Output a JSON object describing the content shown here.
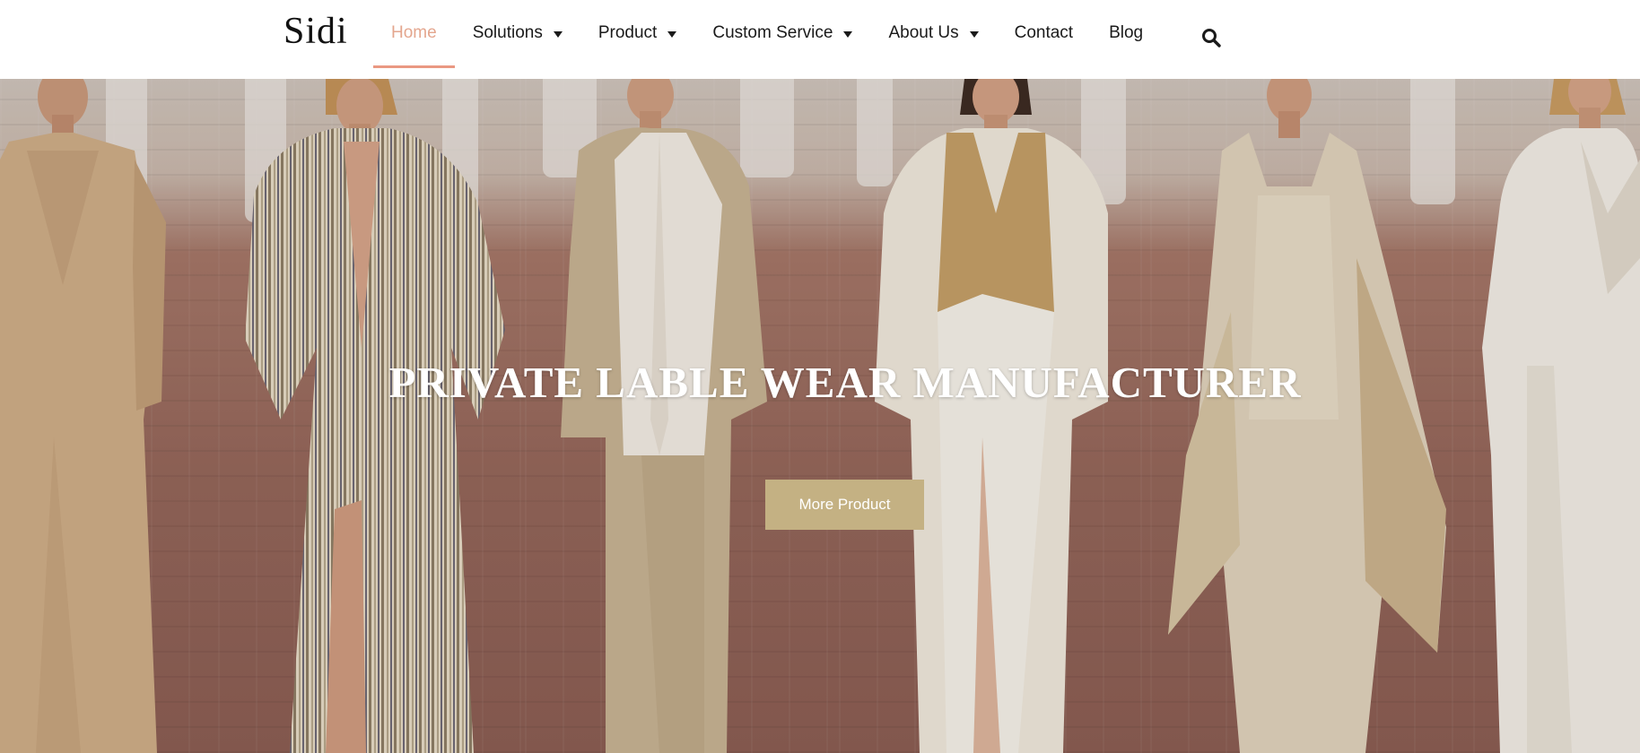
{
  "brand": {
    "logo_text": "Sidi"
  },
  "nav": {
    "items": [
      {
        "label": "Home",
        "has_dropdown": false,
        "active": true
      },
      {
        "label": "Solutions",
        "has_dropdown": true,
        "active": false
      },
      {
        "label": "Product",
        "has_dropdown": true,
        "active": false
      },
      {
        "label": "Custom Service",
        "has_dropdown": true,
        "active": false
      },
      {
        "label": "About Us",
        "has_dropdown": true,
        "active": false
      },
      {
        "label": "Contact",
        "has_dropdown": false,
        "active": false
      },
      {
        "label": "Blog",
        "has_dropdown": false,
        "active": false
      }
    ],
    "search_icon": "search-icon",
    "active_color": "#e4a68e"
  },
  "hero": {
    "title": "PRIVATE LABLE WEAR MANUFACTURER",
    "cta_label": "More Product",
    "cta_color": "#c4b183",
    "panels": [
      {
        "name": "model-beige-dress",
        "garment": "#cfae88",
        "accent": "#b89570"
      },
      {
        "name": "model-striped-shirtdress",
        "garment": "#ddd0b6",
        "accent": "#8a7a66"
      },
      {
        "name": "model-linen-suit",
        "garment": "#c7b394",
        "accent": "#f1ece4"
      },
      {
        "name": "model-white-blazer",
        "garment": "#efe9dd",
        "accent": "#c49f68"
      },
      {
        "name": "model-lace-jumpsuit",
        "garment": "#e0d3bd",
        "accent": "#cbb48f"
      },
      {
        "name": "model-white-dress",
        "garment": "#f1ede6",
        "accent": "#e1dace"
      }
    ]
  }
}
